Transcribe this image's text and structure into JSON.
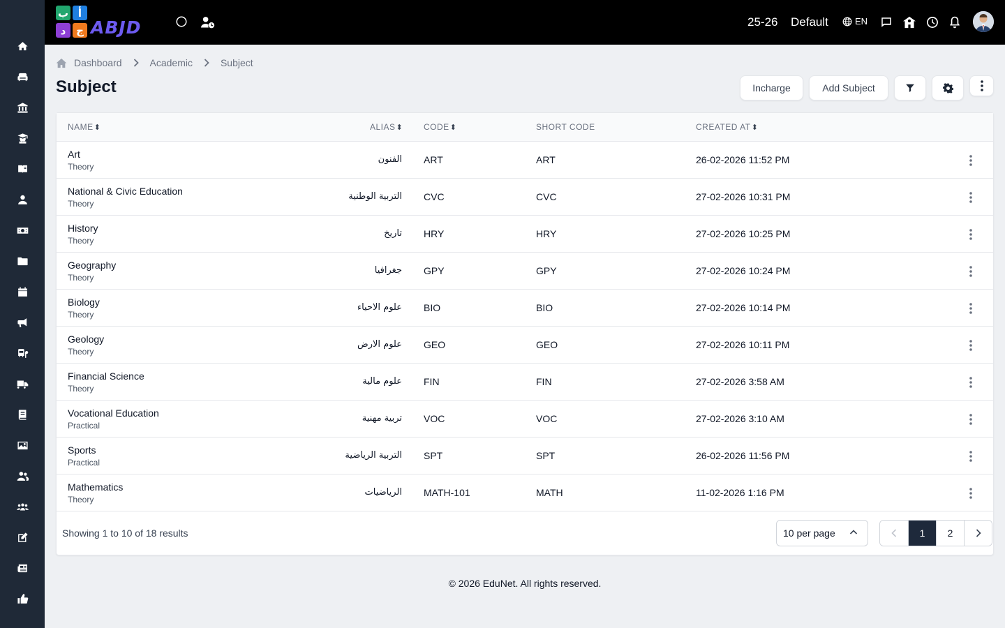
{
  "app": {
    "logo_text": "ABJD",
    "logo_tiles": [
      "ب",
      "أ",
      "د",
      "ج"
    ],
    "session": "25-26",
    "profile": "Default",
    "language": "EN"
  },
  "sidebar": {
    "items": [
      {
        "name": "home-icon"
      },
      {
        "name": "sofa-icon"
      },
      {
        "name": "institution-icon"
      },
      {
        "name": "graduate-icon"
      },
      {
        "name": "book-open-icon"
      },
      {
        "name": "user-icon"
      },
      {
        "name": "money-icon"
      },
      {
        "name": "folder-icon"
      },
      {
        "name": "calendar-icon"
      },
      {
        "name": "megaphone-icon"
      },
      {
        "name": "bus-stop-icon"
      },
      {
        "name": "truck-icon"
      },
      {
        "name": "book-icon"
      },
      {
        "name": "image-icon"
      },
      {
        "name": "users-icon"
      },
      {
        "name": "people-group-icon"
      },
      {
        "name": "edit-icon"
      },
      {
        "name": "newspaper-icon"
      },
      {
        "name": "thumbs-up-icon"
      }
    ]
  },
  "breadcrumb": {
    "items": [
      "Dashboard",
      "Academic",
      "Subject"
    ]
  },
  "page": {
    "title": "Subject"
  },
  "actions": {
    "incharge": "Incharge",
    "add_subject": "Add Subject"
  },
  "table": {
    "columns": {
      "name": "NAME",
      "alias": "ALIAS",
      "code": "CODE",
      "short_code": "SHORT CODE",
      "created_at": "CREATED AT"
    },
    "rows": [
      {
        "name": "Art",
        "type": "Theory",
        "alias": "الفنون",
        "code": "ART",
        "short_code": "ART",
        "created_at": "26-02-2026 11:52 PM"
      },
      {
        "name": "National & Civic Education",
        "type": "Theory",
        "alias": "التربية الوطنية",
        "code": "CVC",
        "short_code": "CVC",
        "created_at": "27-02-2026 10:31 PM"
      },
      {
        "name": "History",
        "type": "Theory",
        "alias": "تاريخ",
        "code": "HRY",
        "short_code": "HRY",
        "created_at": "27-02-2026 10:25 PM"
      },
      {
        "name": "Geography",
        "type": "Theory",
        "alias": "جغرافيا",
        "code": "GPY",
        "short_code": "GPY",
        "created_at": "27-02-2026 10:24 PM"
      },
      {
        "name": "Biology",
        "type": "Theory",
        "alias": "علوم الاحياء",
        "code": "BIO",
        "short_code": "BIO",
        "created_at": "27-02-2026 10:14 PM"
      },
      {
        "name": "Geology",
        "type": "Theory",
        "alias": "علوم الارض",
        "code": "GEO",
        "short_code": "GEO",
        "created_at": "27-02-2026 10:11 PM"
      },
      {
        "name": "Financial Science",
        "type": "Theory",
        "alias": "علوم مالية",
        "code": "FIN",
        "short_code": "FIN",
        "created_at": "27-02-2026 3:58 AM"
      },
      {
        "name": "Vocational Education",
        "type": "Practical",
        "alias": "تربية مهنية",
        "code": "VOC",
        "short_code": "VOC",
        "created_at": "27-02-2026 3:10 AM"
      },
      {
        "name": "Sports",
        "type": "Practical",
        "alias": "التربية الرياضية",
        "code": "SPT",
        "short_code": "SPT",
        "created_at": "26-02-2026 11:56 PM"
      },
      {
        "name": "Mathematics",
        "type": "Theory",
        "alias": "الرياضيات",
        "code": "MATH-101",
        "short_code": "MATH",
        "created_at": "11-02-2026 1:16 PM"
      }
    ]
  },
  "pagination": {
    "showing_text": "Showing 1 to 10 of 18 results",
    "per_page": "10 per page",
    "pages": [
      "1",
      "2"
    ],
    "current_page": "1"
  },
  "footer": {
    "text": "© 2026 EduNet. All rights reserved."
  },
  "colors": {
    "sidebar_bg": "#1f2937",
    "topbar_bg": "#000000",
    "page_bg": "#eef0f3",
    "active_page": "#1e293b"
  }
}
